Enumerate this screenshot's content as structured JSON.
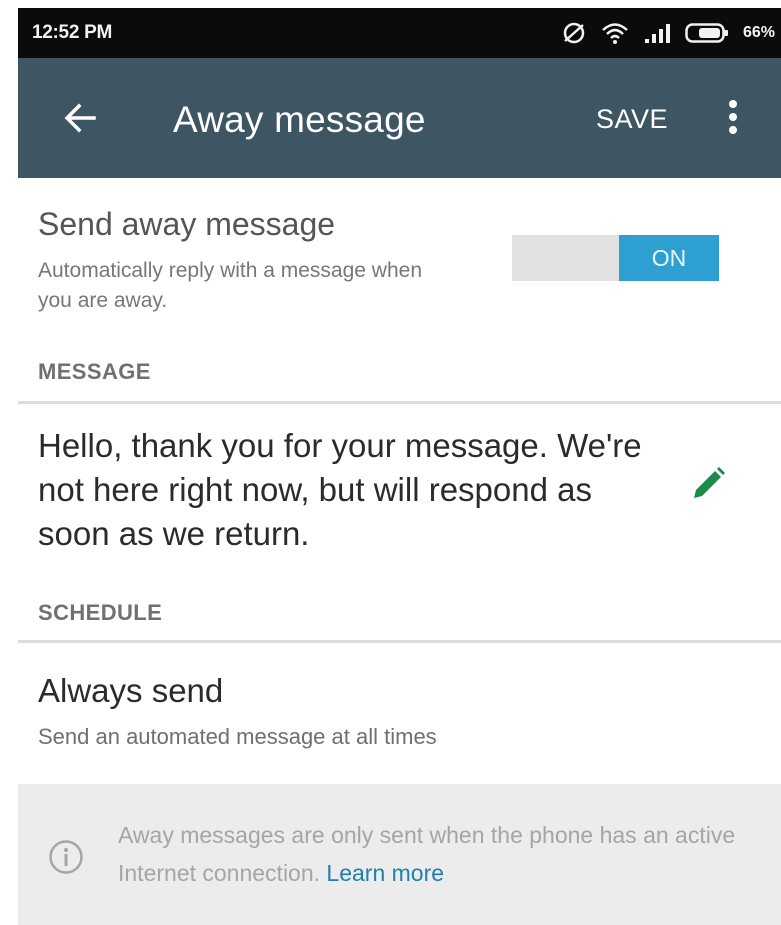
{
  "status_bar": {
    "time": "12:52 PM",
    "battery_percent": "66%",
    "icons": [
      "data-saver-icon",
      "wifi-icon",
      "signal-icon",
      "battery-icon"
    ]
  },
  "app_bar": {
    "title": "Away message",
    "save_label": "SAVE",
    "back_icon": "arrow-left-icon",
    "more_icon": "more-vertical-icon",
    "background_color": "#3e5564"
  },
  "away_toggle": {
    "title": "Send away message",
    "subtitle": "Automatically reply with a message when you are away.",
    "state_label": "ON",
    "on_color": "#2d9fd0"
  },
  "message_section": {
    "header": "MESSAGE",
    "text": "Hello, thank you for your message. We're not here right now, but will respond as soon as we return.",
    "edit_icon": "pencil-icon",
    "edit_icon_color": "#1c8a4a"
  },
  "schedule_section": {
    "header": "SCHEDULE",
    "title": "Always send",
    "subtitle": "Send an automated message at all times"
  },
  "info": {
    "icon": "info-icon",
    "text": "Away messages are only sent when the phone has an active Internet connection.",
    "link_label": "Learn more",
    "link_color": "#1e7fa8"
  }
}
